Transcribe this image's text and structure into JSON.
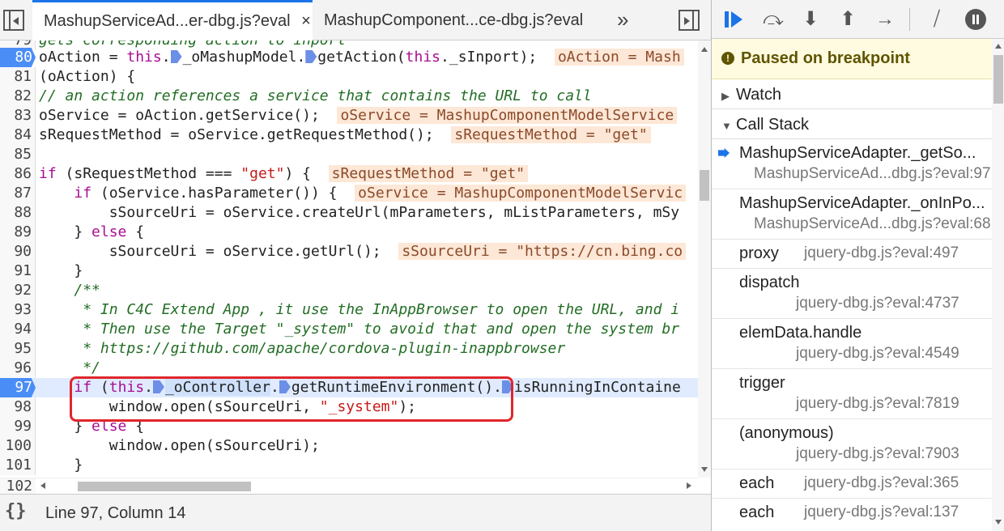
{
  "tabs": {
    "active_label": "MashupServiceAd...er-dbg.js?eval",
    "close_glyph": "×",
    "second_label": "MashupComponent...ce-dbg.js?eval",
    "more_glyph": "»"
  },
  "code": {
    "lines": {
      "l79": {
        "num": "79",
        "text": "gets corresponding action to inport"
      },
      "l80": {
        "num": "80",
        "a": "oAction = ",
        "b": "this",
        "c": ".",
        "d": "_oMashupModel.",
        "e": "getAction(",
        "f": "this",
        "g": "._sInport);",
        "ev": "oAction = Mash"
      },
      "l81": {
        "num": "81",
        "text": "(oAction) {"
      },
      "l82": {
        "num": "82",
        "text": "// an action references a service that contains the URL to call"
      },
      "l83": {
        "num": "83",
        "a": "oService = oAction.getService();",
        "ev": "oService = MashupComponentModelService"
      },
      "l84": {
        "num": "84",
        "a": "sRequestMethod = oService.getRequestMethod();",
        "ev": "sRequestMethod = \"get\""
      },
      "l85": {
        "num": "85"
      },
      "l86": {
        "num": "86",
        "kw": "if",
        "a": " (sRequestMethod === ",
        "str": "\"get\"",
        "b": ") {",
        "ev": "sRequestMethod = \"get\""
      },
      "l87": {
        "num": "87",
        "kw": "if",
        "a": " (oService.hasParameter()) {",
        "ev": "oService = MashupComponentModelServic"
      },
      "l88": {
        "num": "88",
        "a": "sSourceUri = oService.createUrl(mParameters, mListParameters, mSy"
      },
      "l89": {
        "num": "89",
        "a": "} ",
        "kw": "else",
        "b": " {"
      },
      "l90": {
        "num": "90",
        "a": "sSourceUri = oService.getUrl();",
        "ev": "sSourceUri = \"https://cn.bing.co"
      },
      "l91": {
        "num": "91",
        "a": "}"
      },
      "l92": {
        "num": "92",
        "text": "/**"
      },
      "l93": {
        "num": "93",
        "text": " * In C4C Extend App , it use the InAppBrowser to open the URL, and i"
      },
      "l94": {
        "num": "94",
        "text": " * Then use the Target \"_system\" to avoid that and open the system br"
      },
      "l95": {
        "num": "95",
        "text": " * https://github.com/apache/cordova-plugin-inappbrowser"
      },
      "l96": {
        "num": "96",
        "text": " */"
      },
      "l97": {
        "num": "97",
        "kw": "if",
        "a": " (",
        "b": "this",
        "c": ".",
        "d": "_oController",
        "e": ".",
        "f": "getRuntimeEnvironment()",
        "g": ".",
        "h": "isRunningInContaine"
      },
      "l98": {
        "num": "98",
        "a": "window.open(sSourceUri, ",
        "str": "\"_system\"",
        "b": ");"
      },
      "l99": {
        "num": "99",
        "a": "} ",
        "kw": "else",
        "b": " {"
      },
      "l100": {
        "num": "100",
        "a": "window.open(sSourceUri);"
      },
      "l101": {
        "num": "101",
        "a": "}"
      },
      "l102": {
        "num": "102"
      }
    }
  },
  "status": {
    "pretty_print_glyph": "{}",
    "cursor_position": "Line 97, Column 14"
  },
  "debugger": {
    "toolbar": {
      "resume": "resume-icon",
      "step_over": "⤼",
      "step_into": "⬇",
      "step_out": "⬆",
      "step": "→",
      "deactivate": "⧸",
      "pause_exceptions": "pause-circle-icon"
    },
    "paused_icon": "!",
    "paused_text": "Paused on breakpoint",
    "watch_label": "Watch",
    "watch_caret": "▶",
    "call_stack_label": "Call Stack",
    "call_stack_caret": "▼",
    "call_stack": [
      {
        "fn": "MashupServiceAdapter._getSo...",
        "loc": "MashupServiceAd...dbg.js?eval:97"
      },
      {
        "fn": "MashupServiceAdapter._onInPo...",
        "loc": "MashupServiceAd...dbg.js?eval:68"
      },
      {
        "fn": "proxy",
        "loc": "jquery-dbg.js?eval:497"
      },
      {
        "fn": "dispatch",
        "loc": "jquery-dbg.js?eval:4737"
      },
      {
        "fn": "elemData.handle",
        "loc": "jquery-dbg.js?eval:4549"
      },
      {
        "fn": "trigger",
        "loc": "jquery-dbg.js?eval:7819"
      },
      {
        "fn": "(anonymous)",
        "loc": "jquery-dbg.js?eval:7903"
      },
      {
        "fn": "each",
        "loc": "jquery-dbg.js?eval:365"
      },
      {
        "fn": "each",
        "loc": "jquery-dbg.js?eval:137"
      }
    ]
  },
  "colors": {
    "breakpoint": "#4a8df6",
    "highlight_box": "#e0262b",
    "paused_banner": "#fffbe0",
    "eval_bubble": "#fde7d6"
  }
}
